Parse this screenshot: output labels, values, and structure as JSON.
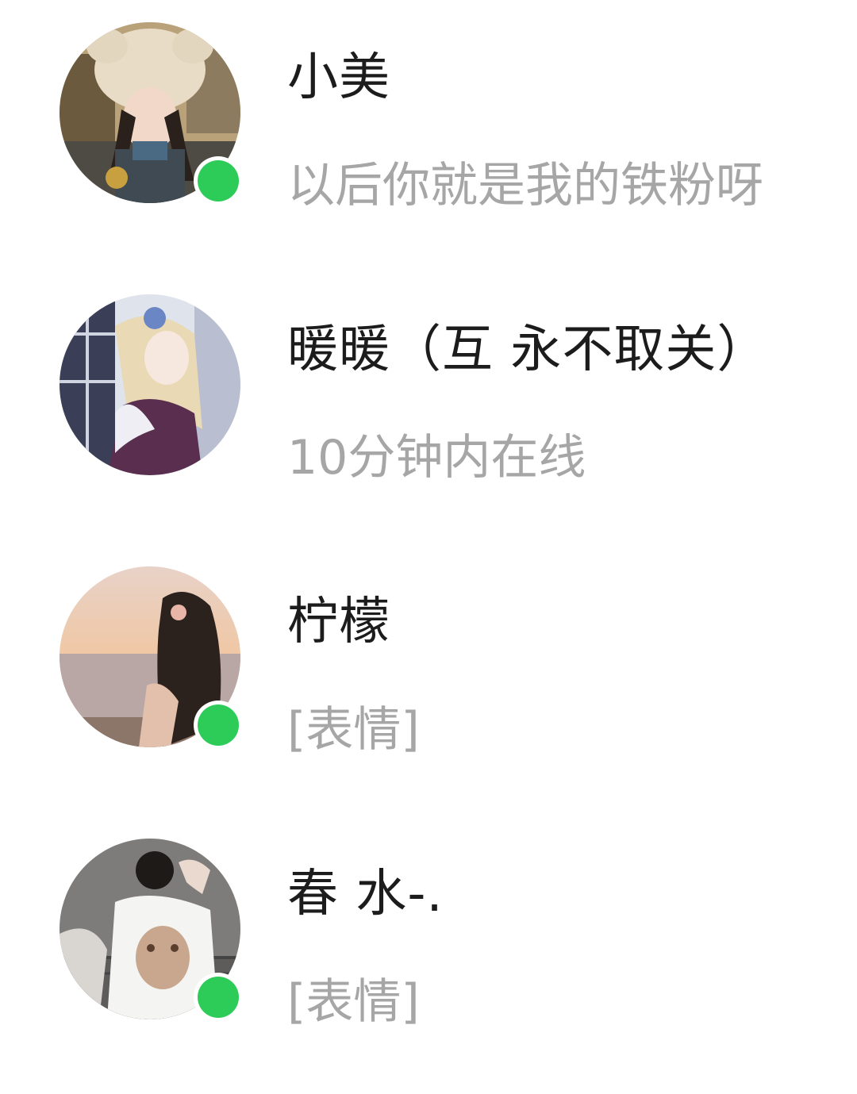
{
  "contacts": [
    {
      "name": "小美",
      "message": "以后你就是我的铁粉呀",
      "online": true,
      "avatar_icon": "girl-in-bear-hat-avatar"
    },
    {
      "name": "暖暖（互 永不取关）",
      "message": "10分钟内在线",
      "online": false,
      "avatar_icon": "anime-girl-avatar"
    },
    {
      "name": "柠檬",
      "message": "[表情]",
      "online": true,
      "avatar_icon": "girl-at-seaside-sunset-avatar"
    },
    {
      "name": "春 水-.",
      "message": "[表情]",
      "online": true,
      "avatar_icon": "girl-in-white-tshirt-avatar"
    }
  ],
  "colors": {
    "online_indicator": "#2dcc59",
    "name_text": "#1c1c1c",
    "message_text": "#a6a6a6",
    "background": "#ffffff"
  }
}
